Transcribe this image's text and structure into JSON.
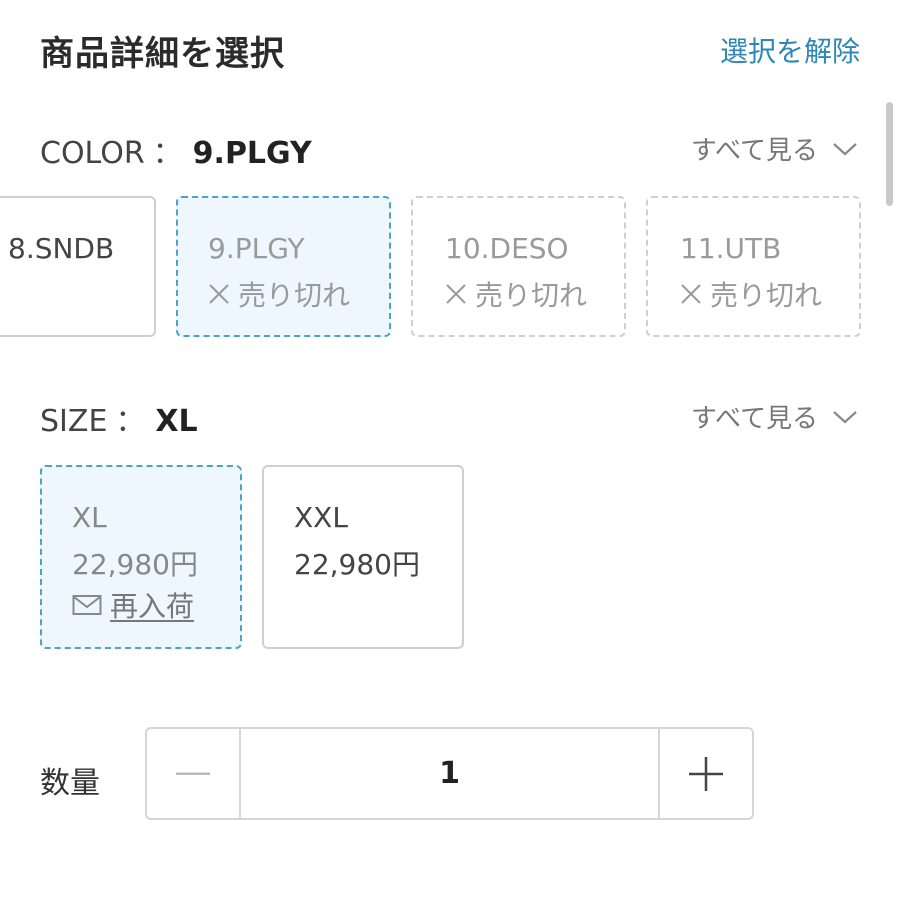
{
  "header": {
    "title": "商品詳細を選択",
    "clear_label": "選択を解除"
  },
  "color": {
    "label": "COLOR",
    "separator": "：",
    "selected_value": "9.PLGY",
    "see_all_label": "すべて見る",
    "options": [
      {
        "name": "8.SNDB",
        "status": "",
        "selected": false
      },
      {
        "name": "9.PLGY",
        "status": "売り切れ",
        "selected": true
      },
      {
        "name": "10.DESO",
        "status": "売り切れ",
        "selected": false
      },
      {
        "name": "11.UTB",
        "status": "売り切れ",
        "selected": false
      }
    ]
  },
  "size": {
    "label": "SIZE",
    "separator": "：",
    "selected_value": "XL",
    "see_all_label": "すべて見る",
    "options": [
      {
        "name": "XL",
        "price": "22,980円",
        "restock_label": "再入荷",
        "selected": true
      },
      {
        "name": "XXL",
        "price": "22,980円",
        "selected": false
      }
    ]
  },
  "quantity": {
    "label": "数量",
    "value": "1"
  },
  "colors": {
    "accent": "#2f87b5",
    "selected_border": "#4aa3c9",
    "selected_bg": "#eef7fd"
  }
}
